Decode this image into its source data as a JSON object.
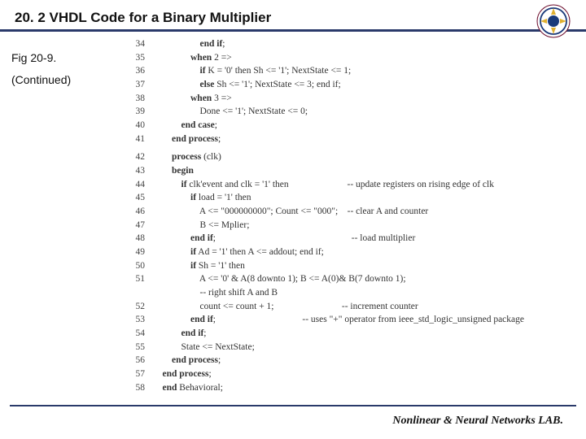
{
  "header": {
    "title": "20. 2 VHDL Code for a Binary Multiplier"
  },
  "sidebar": {
    "fig_label": "Fig 20-9.",
    "continued": "(Continued)"
  },
  "code": {
    "lines": [
      {
        "n": "34",
        "indent": 5,
        "text": "end if;",
        "bold_prefix": 6
      },
      {
        "n": "35",
        "indent": 4,
        "text": "when 2 =>",
        "bold_prefix": 4
      },
      {
        "n": "36",
        "indent": 5,
        "text": "if K = '0' then Sh <= '1'; NextState <= 1;",
        "bold_prefix": 2
      },
      {
        "n": "37",
        "indent": 5,
        "text": "else Sh <= '1'; NextState <= 3; end if;",
        "bold_prefix": 4
      },
      {
        "n": "38",
        "indent": 4,
        "text": "when 3 =>",
        "bold_prefix": 4
      },
      {
        "n": "39",
        "indent": 5,
        "text": "Done <= '1'; NextState <= 0;"
      },
      {
        "n": "40",
        "indent": 3,
        "text": "end case;",
        "bold_prefix": 8
      },
      {
        "n": "41",
        "indent": 2,
        "text": "end process;",
        "bold_prefix": 11
      },
      {
        "gap": true
      },
      {
        "n": "42",
        "indent": 2,
        "text": "process (clk)",
        "bold_prefix": 7
      },
      {
        "n": "43",
        "indent": 2,
        "text": "begin",
        "bold_prefix": 5
      },
      {
        "n": "44",
        "indent": 3,
        "text": "if clk'event and clk = '1' then                         -- update registers on rising edge of clk",
        "bold_prefix": 2
      },
      {
        "n": "45",
        "indent": 4,
        "text": "if load = '1' then",
        "bold_prefix": 2
      },
      {
        "n": "46",
        "indent": 5,
        "text": "A <= \"000000000\"; Count <= \"000\";    -- clear A and counter"
      },
      {
        "n": "47",
        "indent": 5,
        "text": "B <= Mplier;"
      },
      {
        "n": "48",
        "indent": 4,
        "text": "end if;                                                          -- load multiplier",
        "bold_prefix": 6
      },
      {
        "n": "49",
        "indent": 4,
        "text": "if Ad = '1' then A <= addout; end if;",
        "bold_prefix": 2
      },
      {
        "n": "50",
        "indent": 4,
        "text": "if Sh = '1' then",
        "bold_prefix": 2
      },
      {
        "n": "51",
        "indent": 5,
        "text": "A <= '0' & A(8 downto 1); B <= A(0)& B(7 downto 1);"
      },
      {
        "n": "",
        "indent": 5,
        "text": "-- right shift A and B"
      },
      {
        "n": "52",
        "indent": 5,
        "text": "count <= count + 1;                             -- increment counter"
      },
      {
        "n": "53",
        "indent": 4,
        "text": "end if;                                     -- uses \"+\" operator from ieee_std_logic_unsigned package",
        "bold_prefix": 6
      },
      {
        "n": "54",
        "indent": 3,
        "text": "end if;",
        "bold_prefix": 6
      },
      {
        "n": "55",
        "indent": 3,
        "text": "State <= NextState;"
      },
      {
        "n": "56",
        "indent": 2,
        "text": "end process;",
        "bold_prefix": 11
      },
      {
        "n": "57",
        "indent": 1,
        "text": "end process;",
        "bold_prefix": 11
      },
      {
        "n": "58",
        "indent": 1,
        "text": "end Behavioral;",
        "bold_prefix": 3
      }
    ]
  },
  "footer": {
    "lab": "Nonlinear & Neural Networks LAB."
  }
}
